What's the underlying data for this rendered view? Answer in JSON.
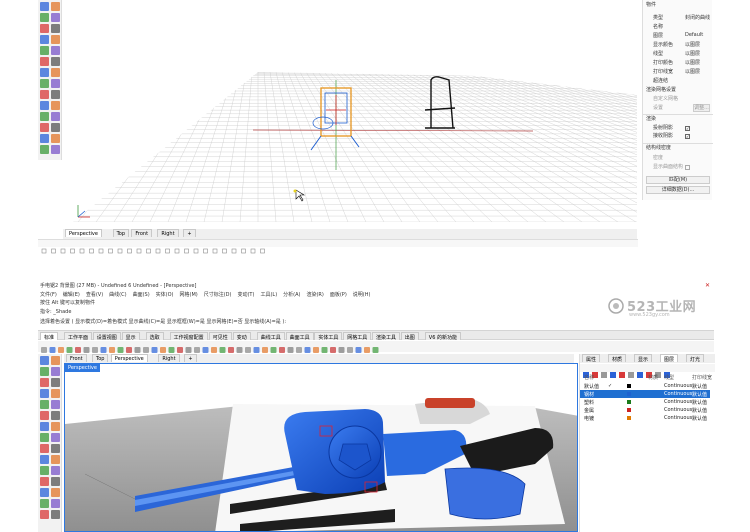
{
  "top": {
    "viewport_tabs": [
      "Perspective",
      "Top",
      "Front",
      "Right"
    ],
    "add_tab": "+",
    "props_section_object": "物件",
    "props": [
      {
        "label": "类型",
        "value": "封闭的曲线"
      },
      {
        "label": "名称",
        "value": ""
      },
      {
        "label": "图层",
        "value": "Default"
      },
      {
        "label": "显示颜色",
        "value": "以图层"
      },
      {
        "label": "线型",
        "value": "以图层"
      },
      {
        "label": "打印颜色",
        "value": "以图层"
      },
      {
        "label": "打印线宽",
        "value": "以图层"
      },
      {
        "label": "超连结",
        "value": ""
      }
    ],
    "render_mesh_section": "渲染网格设置",
    "render_mesh_custom": "自定义网格",
    "render_mesh_settings": "设置",
    "render_mesh_btn": "调整...",
    "render_section": "渲染",
    "cast_shadows": "投射阴影",
    "receive_shadows": "接收阴影",
    "structure_section": "结构线密度",
    "density": "密度",
    "show_surface_structure": "显示曲面结构",
    "match_btn": "匹配(M)",
    "details_btn": "详细数据(D)..."
  },
  "bottom": {
    "title": "手电锯2 背景图 (27 MB) - Undefined 6 Undefined - [Perspective]",
    "menu": [
      "文件(F)",
      "编辑(E)",
      "查看(V)",
      "曲线(C)",
      "曲面(S)",
      "实体(O)",
      "网格(M)",
      "尺寸标注(D)",
      "变动(T)",
      "工具(L)",
      "分析(A)",
      "渲染(R)",
      "面板(P)",
      "说明(H)"
    ],
    "hint_line": "按住 Alt 键可以复制物件",
    "command_line": "指令: _Shade",
    "selection_line": "选择着色设置 ( 显示模式(D)=着色模式  显示曲线(C)=是  显示框框(W)=是  显示网格(E)=否  显示轴线(A)=是 ):",
    "toolbar_tabs": [
      "标准",
      "工作平面",
      "设置视图",
      "显示",
      "选取",
      "工作视窗配置",
      "可见性",
      "变动",
      "曲线工具",
      "曲面工具",
      "实体工具",
      "网格工具",
      "渲染工具",
      "出图",
      "V6 的新功能"
    ],
    "viewport_tabs": [
      "Front",
      "Top",
      "Perspective",
      "Right"
    ],
    "viewport_label": "Perspective",
    "watermark_line1": "523工业网",
    "watermark_line2": "www.523gy.com",
    "panel_tabs": [
      "属性",
      "材质",
      "显示",
      "图层",
      "灯光"
    ],
    "layer_headers": {
      "name": "名称",
      "material": "材质",
      "linetype": "线型",
      "width": "打印线宽"
    },
    "layers": [
      {
        "name": "默认值",
        "linetype": "Continuous",
        "width": "默认值",
        "color": "#000000",
        "selected": false
      },
      {
        "name": "钢材",
        "linetype": "Continuous",
        "width": "默认值",
        "color": "#1e62d0",
        "selected": true
      },
      {
        "name": "塑料",
        "linetype": "Continuous",
        "width": "默认值",
        "color": "#1a7a1a",
        "selected": false
      },
      {
        "name": "金属",
        "linetype": "Continuous",
        "width": "默认值",
        "color": "#cc2222",
        "selected": false
      },
      {
        "name": "电镀",
        "linetype": "Continuous",
        "width": "默认值",
        "color": "#e07a00",
        "selected": false
      }
    ],
    "checkmark": "✓",
    "default_layer_tag": "图层",
    "colors": {
      "accent": "#1f6fd1",
      "tool_blue": "#1657d6",
      "tool_orange": "#e6501e"
    }
  }
}
